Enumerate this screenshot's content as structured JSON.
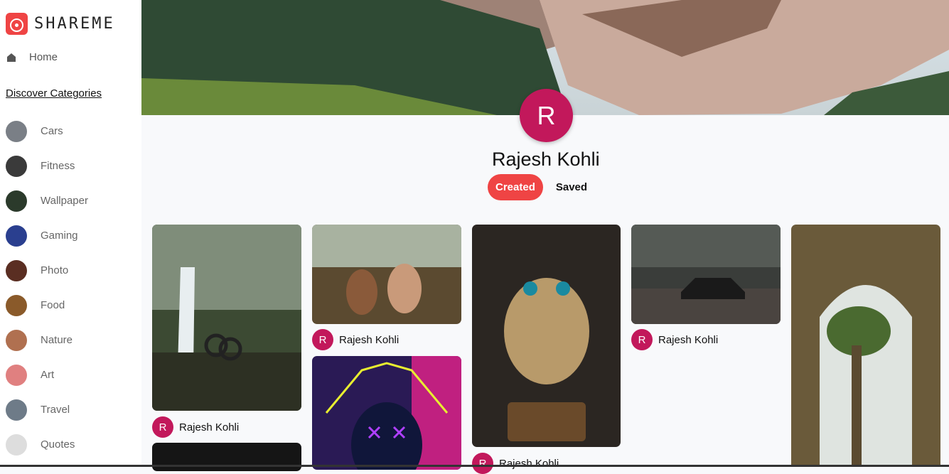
{
  "app": {
    "brand": "SHAREME"
  },
  "sidebar": {
    "home_label": "Home",
    "categories_heading": "Discover Categories",
    "categories": [
      {
        "label": "Cars",
        "color": "#7a7f86"
      },
      {
        "label": "Fitness",
        "color": "#3a3a3a"
      },
      {
        "label": "Wallpaper",
        "color": "#2b3a2b"
      },
      {
        "label": "Gaming",
        "color": "#2a3f8f"
      },
      {
        "label": "Photo",
        "color": "#5a2e22"
      },
      {
        "label": "Food",
        "color": "#8a5a2a"
      },
      {
        "label": "Nature",
        "color": "#b07050"
      },
      {
        "label": "Art",
        "color": "#e08080"
      },
      {
        "label": "Travel",
        "color": "#6e7b88"
      },
      {
        "label": "Quotes",
        "color": "#dddddd"
      }
    ]
  },
  "profile": {
    "avatar_initial": "R",
    "name": "Rajesh Kohli",
    "tabs": {
      "created": "Created",
      "saved": "Saved"
    }
  },
  "pins": [
    {
      "user_initial": "R",
      "user_name": "Rajesh Kohli"
    },
    {
      "user_initial": "R",
      "user_name": "Rajesh Kohli"
    },
    {
      "user_initial": "R",
      "user_name": "Rajesh Kohli"
    },
    {
      "user_initial": "R",
      "user_name": "Rajesh Kohli"
    }
  ],
  "colors": {
    "accent": "#ef4444",
    "avatar": "#c2185b"
  }
}
